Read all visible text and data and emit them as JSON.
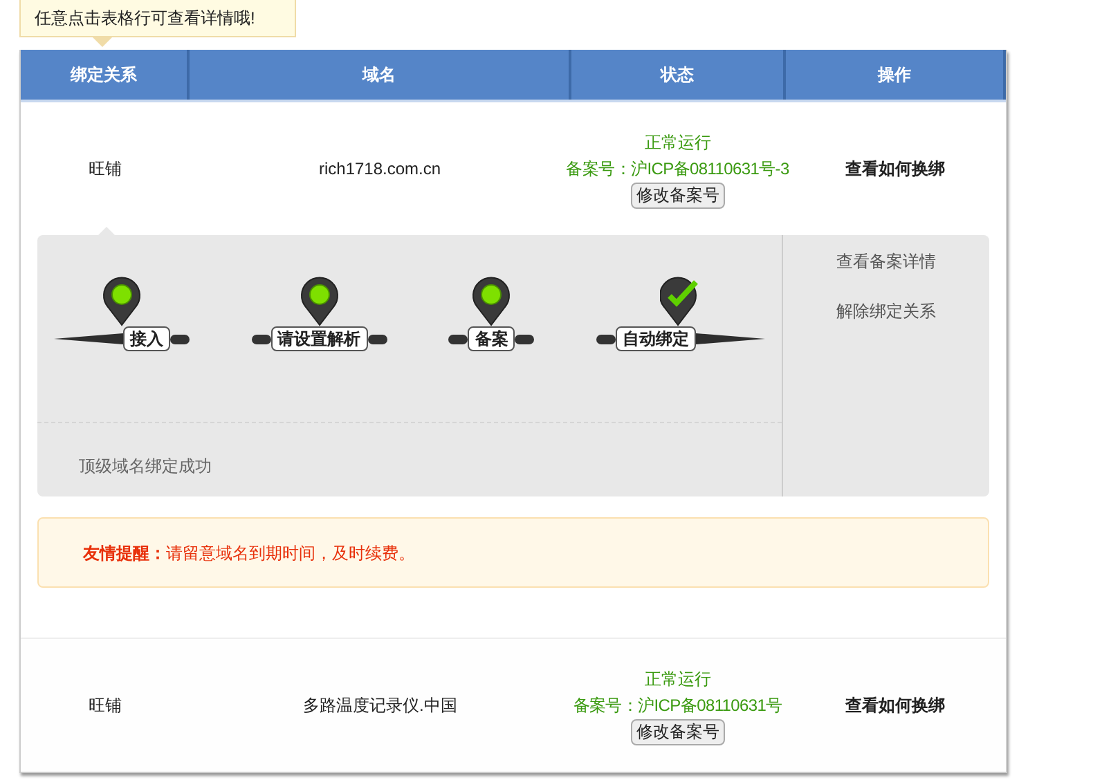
{
  "tooltip": {
    "text": "任意点击表格行可查看详情哦!"
  },
  "table": {
    "columns": [
      "绑定关系",
      "域名",
      "状态",
      "操作"
    ],
    "rows": [
      {
        "binding": "旺铺",
        "domain": "rich1718.com.cn",
        "status": "正常运行",
        "record": "备案号：沪ICP备08110631号-3",
        "edit_button": "修改备案号",
        "action": "查看如何换绑",
        "expanded": true,
        "detail": {
          "steps": [
            {
              "kind": "dot",
              "label": "接入"
            },
            {
              "kind": "dot",
              "label": "请设置解析"
            },
            {
              "kind": "dot",
              "label": "备案"
            },
            {
              "kind": "check",
              "label": "自动绑定"
            }
          ],
          "message": "顶级域名绑定成功",
          "links": [
            "查看备案详情",
            "解除绑定关系"
          ]
        },
        "notice": "**友情提醒：**请留意域名到期时间，及时续费。"
      },
      {
        "binding": "旺铺",
        "domain": "多路温度记录仪.中国",
        "status": "正常运行",
        "record": "备案号：沪ICP备08110631号",
        "edit_button": "修改备案号",
        "action": "查看如何换绑",
        "expanded": false
      }
    ]
  }
}
